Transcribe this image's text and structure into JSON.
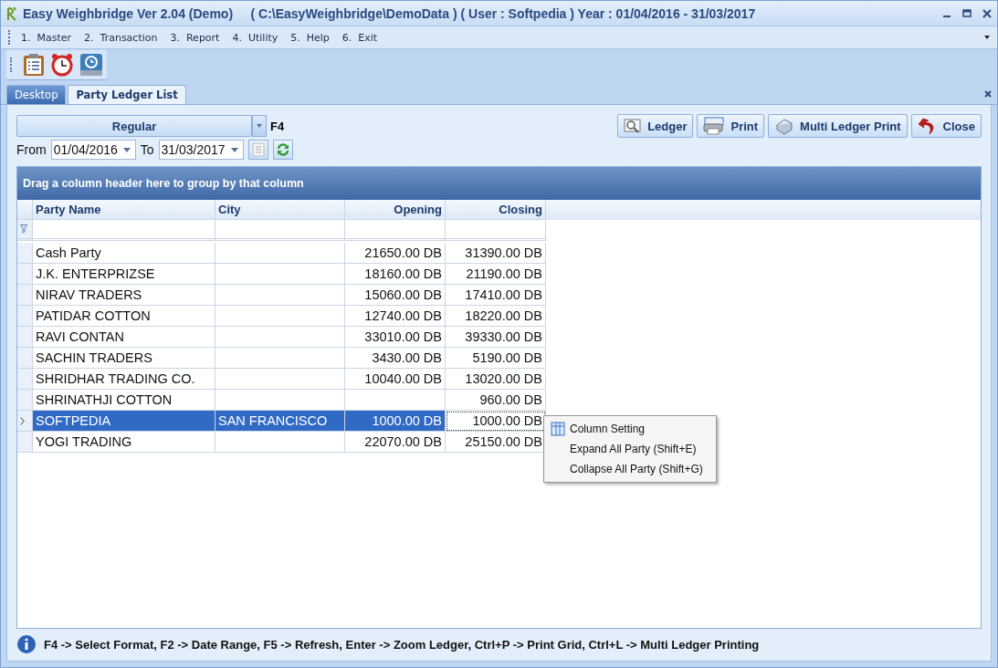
{
  "window": {
    "title": "Easy Weighbridge Ver 2.04 (Demo)     ( C:\\EasyWeighbridge\\DemoData ) ( User : Softpedia ) Year : 01/04/2016 - 31/03/2017"
  },
  "menu": [
    "1.  Master",
    "2.  Transaction",
    "3.  Report",
    "4.  Utility",
    "5.  Help",
    "6.  Exit"
  ],
  "tabs": [
    {
      "label": "Desktop",
      "selected": false
    },
    {
      "label": "Party Ledger List",
      "selected": true
    }
  ],
  "format": {
    "value": "Regular",
    "hotkey": "F4"
  },
  "date_range": {
    "from_label": "From",
    "from": "01/04/2016",
    "to_label": "To",
    "to": "31/03/2017"
  },
  "buttons": [
    {
      "label": "Ledger",
      "kind": "ledger"
    },
    {
      "label": "Print",
      "kind": "print"
    },
    {
      "label": "Multi Ledger Print",
      "kind": "multi"
    },
    {
      "label": "Close",
      "kind": "close"
    }
  ],
  "grid": {
    "group_hint": "Drag a column header here to group by that column",
    "columns": [
      "Party Name",
      "City",
      "Opening",
      "Closing"
    ],
    "rows": [
      {
        "cells": [
          "Cash Party",
          "",
          "21650.00 DB",
          "31390.00 DB"
        ],
        "selected": false
      },
      {
        "cells": [
          "J.K. ENTERPRIZSE",
          "",
          "18160.00 DB",
          "21190.00 DB"
        ],
        "selected": false
      },
      {
        "cells": [
          "NIRAV TRADERS",
          "",
          "15060.00 DB",
          "17410.00 DB"
        ],
        "selected": false
      },
      {
        "cells": [
          "PATIDAR COTTON",
          "",
          "12740.00 DB",
          "18220.00 DB"
        ],
        "selected": false
      },
      {
        "cells": [
          "RAVI CONTAN",
          "",
          "33010.00 DB",
          "39330.00 DB"
        ],
        "selected": false
      },
      {
        "cells": [
          "SACHIN TRADERS",
          "",
          "3430.00 DB",
          "5190.00 DB"
        ],
        "selected": false
      },
      {
        "cells": [
          "SHRIDHAR TRADING CO.",
          "",
          "10040.00 DB",
          "13020.00 DB"
        ],
        "selected": false
      },
      {
        "cells": [
          "SHRINATHJI COTTON",
          "",
          "",
          "960.00 DB"
        ],
        "selected": false
      },
      {
        "cells": [
          "SOFTPEDIA",
          "SAN FRANCISCO",
          "1000.00 DB",
          "1000.00 DB"
        ],
        "selected": true
      },
      {
        "cells": [
          "YOGI TRADING",
          "",
          "22070.00 DB",
          "25150.00 DB"
        ],
        "selected": false
      }
    ]
  },
  "context_menu": [
    {
      "label": "Column Setting",
      "icon": true
    },
    {
      "label": "Expand All Party (Shift+E)",
      "icon": false
    },
    {
      "label": "Collapse All Party (Shift+G)",
      "icon": false
    }
  ],
  "status_bar": {
    "text": "F4 -> Select Format, F2 -> Date Range, F5 -> Refresh, Enter -> Zoom Ledger, Ctrl+P -> Print Grid, Ctrl+L -> Multi Ledger Printing"
  }
}
